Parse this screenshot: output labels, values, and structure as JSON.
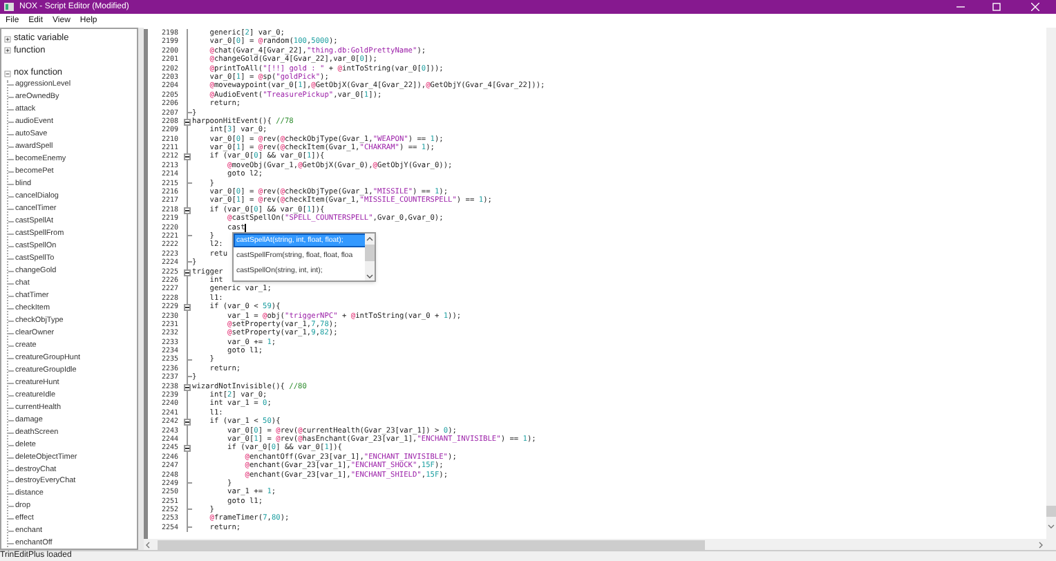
{
  "window": {
    "title": "NOX - Script Editor (Modified)"
  },
  "menu": [
    "File",
    "Edit",
    "View",
    "Help"
  ],
  "tree": [
    {
      "label": "static variable",
      "expanded": false
    },
    {
      "label": "function",
      "expanded": false
    },
    {
      "label": "nox function",
      "expanded": true,
      "children": [
        {
          "label": "aggressionLevel"
        },
        {
          "label": "areOwnedBy"
        },
        {
          "label": "attack"
        },
        {
          "label": "audioEvent"
        },
        {
          "label": "autoSave"
        },
        {
          "label": "awardSpell"
        },
        {
          "label": "becomeEnemy"
        },
        {
          "label": "becomePet"
        },
        {
          "label": "blind"
        },
        {
          "label": "cancelDialog"
        },
        {
          "label": "cancelTimer"
        },
        {
          "label": "castSpellAt"
        },
        {
          "label": "castSpellFrom"
        },
        {
          "label": "castSpellOn"
        },
        {
          "label": "castSpellTo"
        },
        {
          "label": "changeGold"
        },
        {
          "label": "chat"
        },
        {
          "label": "chatTimer"
        },
        {
          "label": "checkItem"
        },
        {
          "label": "checkObjType"
        },
        {
          "label": "clearOwner"
        },
        {
          "label": "create"
        },
        {
          "label": "creatureGroupHunt"
        },
        {
          "label": "creatureGroupIdle"
        },
        {
          "label": "creatureHunt"
        },
        {
          "label": "creatureIdle"
        },
        {
          "label": "currentHealth"
        },
        {
          "label": "damage"
        },
        {
          "label": "deathScreen"
        },
        {
          "label": "delete"
        },
        {
          "label": "deleteObjectTimer"
        },
        {
          "label": "destroyChat"
        },
        {
          "label": "destroyEveryChat"
        },
        {
          "label": "distance"
        },
        {
          "label": "drop"
        },
        {
          "label": "effect"
        },
        {
          "label": "enchant"
        },
        {
          "label": "enchantOff"
        }
      ]
    }
  ],
  "editor": {
    "lines": [
      {
        "number": "2198",
        "text": "    generic[2] var_0;",
        "kind": "plain",
        "caret": false
      },
      {
        "number": "2199",
        "text": "    var_0[0] = @random(100,5000);",
        "kind": "plain",
        "caret": false
      },
      {
        "number": "2200",
        "text": "    @chat(Gvar_4[Gvar_22],\"thing.db:GoldPrettyName\");",
        "kind": "plain",
        "caret": false
      },
      {
        "number": "2201",
        "text": "    @changeGold(Gvar_4[Gvar_22],var_0[0]);",
        "kind": "plain",
        "caret": false
      },
      {
        "number": "2202",
        "text": "    @printToAll(\"[!!] gold : \" + @intToString(var_0[0]));",
        "kind": "plain",
        "caret": false
      },
      {
        "number": "2203",
        "text": "    var_0[1] = @sp(\"goldPick\");",
        "kind": "plain",
        "caret": false
      },
      {
        "number": "2204",
        "text": "    @movewaypoint(var_0[1],@GetObjX(Gvar_4[Gvar_22]),@GetObjY(Gvar_4[Gvar_22]));",
        "kind": "plain",
        "caret": false
      },
      {
        "number": "2205",
        "text": "    @AudioEvent(\"TreasurePickup\",var_0[1]);",
        "kind": "plain",
        "caret": false
      },
      {
        "number": "2206",
        "text": "    return;",
        "kind": "plain",
        "caret": false
      },
      {
        "number": "2207",
        "text": "}",
        "kind": "end",
        "caret": false
      },
      {
        "number": "2208",
        "text": "harpoonHitEvent(){ //78",
        "kind": "start",
        "caret": false
      },
      {
        "number": "2209",
        "text": "    int[3] var_0;",
        "kind": "plain",
        "caret": false
      },
      {
        "number": "2210",
        "text": "    var_0[0] = @rev(@checkObjType(Gvar_1,\"WEAPON\") == 1);",
        "kind": "plain",
        "caret": false
      },
      {
        "number": "2211",
        "text": "    var_0[1] = @rev(@checkItem(Gvar_1,\"CHAKRAM\") == 1);",
        "kind": "plain",
        "caret": false
      },
      {
        "number": "2212",
        "text": "    if (var_0[0] && var_0[1]){",
        "kind": "start",
        "caret": false
      },
      {
        "number": "2213",
        "text": "        @moveObj(Gvar_1,@GetObjX(Gvar_0),@GetObjY(Gvar_0));",
        "kind": "plain",
        "caret": false
      },
      {
        "number": "2214",
        "text": "        goto l2;",
        "kind": "plain",
        "caret": false
      },
      {
        "number": "2215",
        "text": "    }",
        "kind": "end",
        "caret": false
      },
      {
        "number": "2216",
        "text": "    var_0[0] = @rev(@checkObjType(Gvar_1,\"MISSILE\") == 1);",
        "kind": "plain",
        "caret": false
      },
      {
        "number": "2217",
        "text": "    var_0[1] = @rev(@checkItem(Gvar_1,\"MISSILE_COUNTERSPELL\") == 1);",
        "kind": "plain",
        "caret": false
      },
      {
        "number": "2218",
        "text": "    if (var_0[0] && var_0[1]){",
        "kind": "start",
        "caret": false
      },
      {
        "number": "2219",
        "text": "        @castSpellOn(\"SPELL_COUNTERSPELL\",Gvar_0,Gvar_0);",
        "kind": "plain",
        "caret": false
      },
      {
        "number": "2220",
        "text": "        cast",
        "kind": "plain",
        "caret": true
      },
      {
        "number": "2221",
        "text": "    }",
        "kind": "end",
        "caret": false
      },
      {
        "number": "2222",
        "text": "    l2:",
        "kind": "plain",
        "caret": false
      },
      {
        "number": "2223",
        "text": "    retu",
        "kind": "plain",
        "caret": false
      },
      {
        "number": "2224",
        "text": "}",
        "kind": "end",
        "caret": false
      },
      {
        "number": "2225",
        "text": "trigger",
        "kind": "start",
        "caret": false
      },
      {
        "number": "2226",
        "text": "    int",
        "kind": "plain",
        "caret": false
      },
      {
        "number": "2227",
        "text": "    generic var_1;",
        "kind": "plain",
        "caret": false
      },
      {
        "number": "2228",
        "text": "    l1:",
        "kind": "plain",
        "caret": false
      },
      {
        "number": "2229",
        "text": "    if (var_0 < 59){",
        "kind": "start",
        "caret": false
      },
      {
        "number": "2230",
        "text": "        var_1 = @obj(\"triggerNPC\" + @intToString(var_0 + 1));",
        "kind": "plain",
        "caret": false
      },
      {
        "number": "2231",
        "text": "        @setProperty(var_1,7,78);",
        "kind": "plain",
        "caret": false
      },
      {
        "number": "2232",
        "text": "        @setProperty(var_1,9,82);",
        "kind": "plain",
        "caret": false
      },
      {
        "number": "2233",
        "text": "        var_0 += 1;",
        "kind": "plain",
        "caret": false
      },
      {
        "number": "2234",
        "text": "        goto l1;",
        "kind": "plain",
        "caret": false
      },
      {
        "number": "2235",
        "text": "    }",
        "kind": "end",
        "caret": false
      },
      {
        "number": "2236",
        "text": "    return;",
        "kind": "plain",
        "caret": false
      },
      {
        "number": "2237",
        "text": "}",
        "kind": "end",
        "caret": false
      },
      {
        "number": "2238",
        "text": "wizardNotInvisible(){ //80",
        "kind": "start",
        "caret": false
      },
      {
        "number": "2239",
        "text": "    int[2] var_0;",
        "kind": "plain",
        "caret": false
      },
      {
        "number": "2240",
        "text": "    int var_1 = 0;",
        "kind": "plain",
        "caret": false
      },
      {
        "number": "2241",
        "text": "    l1:",
        "kind": "plain",
        "caret": false
      },
      {
        "number": "2242",
        "text": "    if (var_1 < 50){",
        "kind": "start",
        "caret": false
      },
      {
        "number": "2243",
        "text": "        var_0[0] = @rev(@currentHealth(Gvar_23[var_1]) > 0);",
        "kind": "plain",
        "caret": false
      },
      {
        "number": "2244",
        "text": "        var_0[1] = @rev(@hasEnchant(Gvar_23[var_1],\"ENCHANT_INVISIBLE\") == 1);",
        "kind": "plain",
        "caret": false
      },
      {
        "number": "2245",
        "text": "        if (var_0[0] && var_0[1]){",
        "kind": "start",
        "caret": false
      },
      {
        "number": "2246",
        "text": "            @enchantOff(Gvar_23[var_1],\"ENCHANT_INVISIBLE\");",
        "kind": "plain",
        "caret": false
      },
      {
        "number": "2247",
        "text": "            @enchant(Gvar_23[var_1],\"ENCHANT_SHOCK\",15F);",
        "kind": "plain",
        "caret": false
      },
      {
        "number": "2248",
        "text": "            @enchant(Gvar_23[var_1],\"ENCHANT_SHIELD\",15F);",
        "kind": "plain",
        "caret": false
      },
      {
        "number": "2249",
        "text": "        }",
        "kind": "end",
        "caret": false
      },
      {
        "number": "2250",
        "text": "        var_1 += 1;",
        "kind": "plain",
        "caret": false
      },
      {
        "number": "2251",
        "text": "        goto l1;",
        "kind": "plain",
        "caret": false
      },
      {
        "number": "2252",
        "text": "    }",
        "kind": "end",
        "caret": false
      },
      {
        "number": "2253",
        "text": "    @frameTimer(7,80);",
        "kind": "plain",
        "caret": false
      },
      {
        "number": "2254",
        "text": "    return;",
        "kind": "end",
        "caret": false
      }
    ],
    "autocomplete": [
      {
        "label": "castSpellAt(string, int, float, float);",
        "selected": true
      },
      {
        "label": "castSpellFrom(string, float, float, floa",
        "selected": false
      },
      {
        "label": "castSpellOn(string, int, int);",
        "selected": false
      }
    ]
  },
  "status_bar": "TrinEditPlus loaded"
}
